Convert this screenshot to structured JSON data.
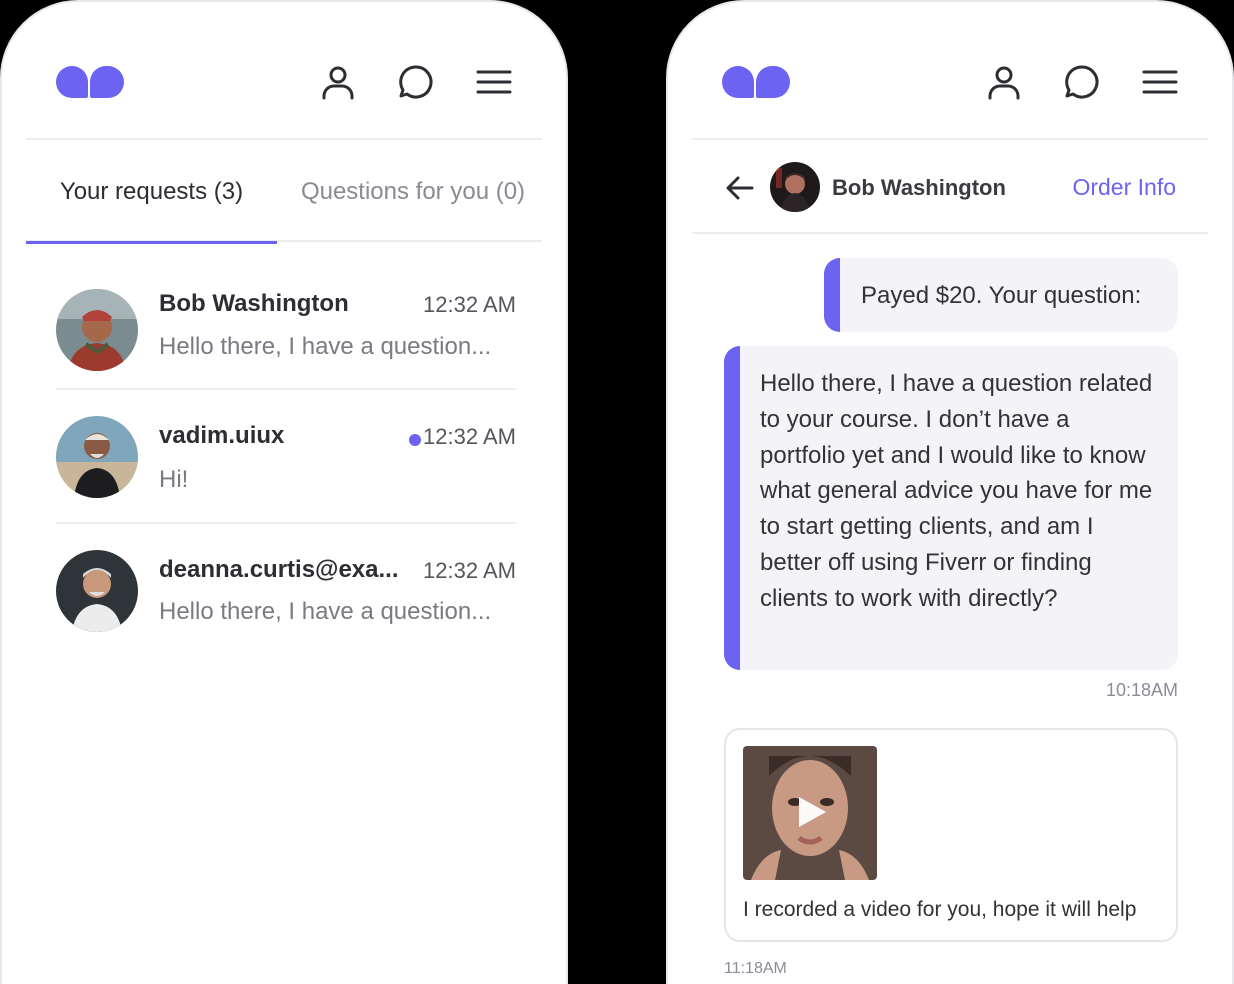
{
  "left_screen": {
    "tabs": [
      {
        "label": "Your requests (3)"
      },
      {
        "label": "Questions for you (0)"
      }
    ],
    "conversations": [
      {
        "name": "Bob Washington",
        "time": "12:32 AM",
        "preview": "Hello there, I have a question...",
        "unread": false
      },
      {
        "name": "vadim.uiux",
        "time": "12:32 AM",
        "preview": "Hi!",
        "unread": true
      },
      {
        "name": "deanna.curtis@exa...",
        "time": "12:32 AM",
        "preview": "Hello there, I have a question...",
        "unread": false
      }
    ]
  },
  "right_screen": {
    "chat": {
      "contact_name": "Bob Washington",
      "order_info_label": "Order Info",
      "messages": {
        "paid": "Payed $20. Your question:",
        "question": "Hello there, I have a question related to your course. I don’t have a portfolio yet and I would like to know what general advice you have for me to start getting clients, and am I better off using Fiverr or finding clients to work with directly?",
        "question_time": "10:18AM",
        "video_caption": "I recorded a video for you, hope it will help",
        "video_time": "11:18AM"
      }
    }
  },
  "icons": [
    "brand-logo",
    "user-icon",
    "chat-bubble-icon",
    "hamburger-menu-icon",
    "back-arrow-icon",
    "play-icon"
  ],
  "colors": {
    "accent": "#6c63f2",
    "bubble": "#f4f3f8",
    "divider": "#ececef",
    "background": "#000000"
  }
}
